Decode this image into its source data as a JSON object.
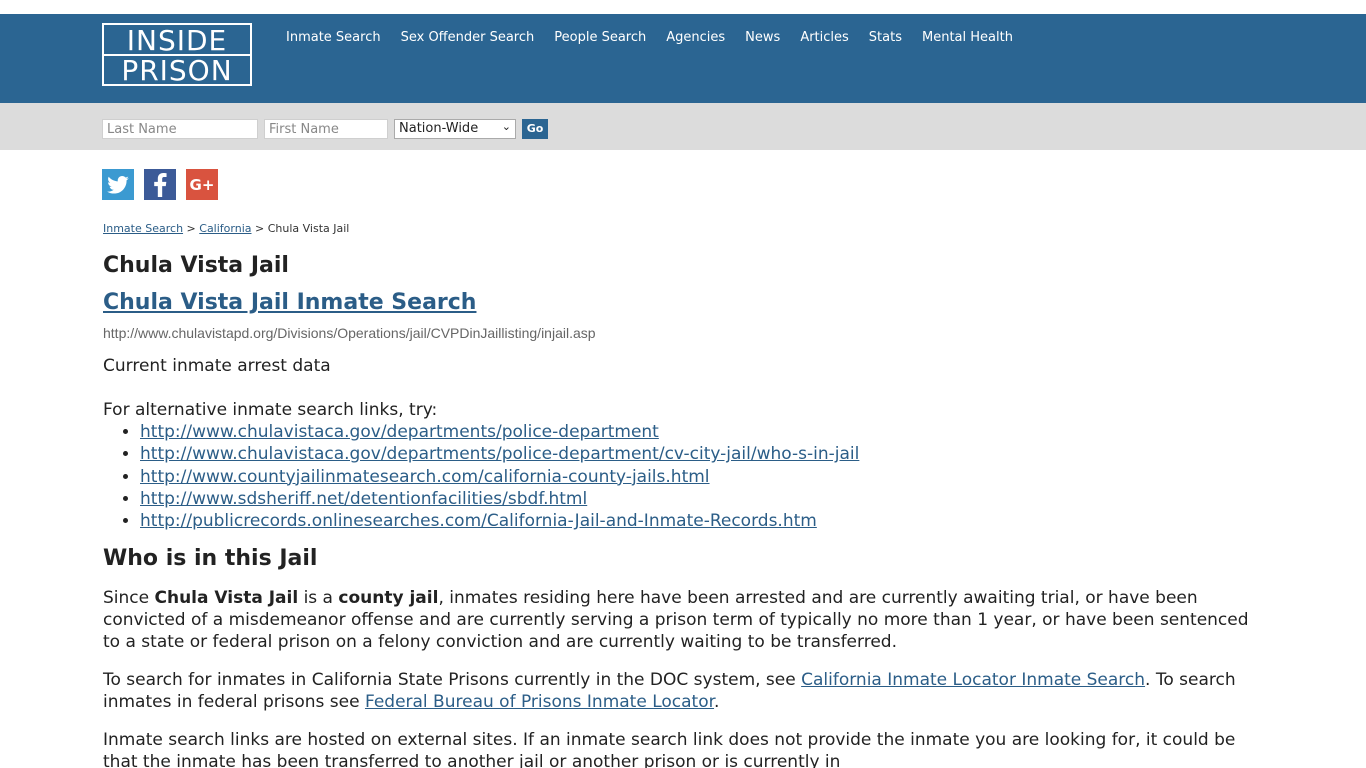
{
  "header": {
    "logo_line1": "INSIDE",
    "logo_line2": "PRISON",
    "nav": [
      "Inmate Search",
      "Sex Offender Search",
      "People Search",
      "Agencies",
      "News",
      "Articles",
      "Stats",
      "Mental Health"
    ]
  },
  "search": {
    "last_name_placeholder": "Last Name",
    "first_name_placeholder": "First Name",
    "scope_selected": "Nation-Wide",
    "go_label": "Go"
  },
  "social": [
    "twitter-icon",
    "facebook-icon",
    "google-plus-icon"
  ],
  "breadcrumb": {
    "item1": "Inmate Search",
    "sep1": " > ",
    "item2": "California",
    "sep2": " > ",
    "current": "Chula Vista Jail"
  },
  "page": {
    "title": "Chula Vista Jail",
    "search_link": "Chula Vista Jail Inmate Search",
    "url": "http://www.chulavistapd.org/Divisions/Operations/jail/CVPDinJaillisting/injail.asp",
    "description": "Current inmate arrest data",
    "alt_intro": "For alternative inmate search links, try:",
    "alt_links": [
      "http://www.chulavistaca.gov/departments/police-department",
      "http://www.chulavistaca.gov/departments/police-department/cv-city-jail/who-s-in-jail",
      "http://www.countyjailinmatesearch.com/california-county-jails.html",
      "http://www.sdsheriff.net/detentionfacilities/sbdf.html",
      "http://publicrecords.onlinesearches.com/California-Jail-and-Inmate-Records.htm"
    ],
    "who_heading": "Who is in this Jail",
    "who_p1_a": "Since ",
    "who_p1_b": "Chula Vista Jail",
    "who_p1_c": " is a ",
    "who_p1_d": "county jail",
    "who_p1_e": ", inmates residing here have been arrested and are currently awaiting trial, or have been convicted of a misdemeanor offense and are currently serving a prison term of typically no more than 1 year, or have been sentenced to a state or federal prison on a felony conviction and are currently waiting to be transferred.",
    "who_p2_a": "To search for inmates in California State Prisons currently in the DOC system, see ",
    "who_p2_link1": "California Inmate Locator Inmate Search",
    "who_p2_b": ". To search inmates in federal prisons see ",
    "who_p2_link2": "Federal Bureau of Prisons Inmate Locator",
    "who_p2_c": ".",
    "who_p3": "Inmate search links are hosted on external sites. If an inmate search link does not provide the inmate you are looking for, it could be that the inmate has been transferred to another jail or another prison or is currently in"
  },
  "colors": {
    "header_bg": "#2b6592",
    "searchbar_bg": "#dcdcdc",
    "link": "#2b5d87"
  }
}
